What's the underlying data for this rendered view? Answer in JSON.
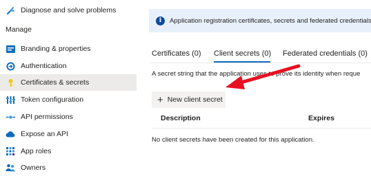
{
  "sidebar": {
    "top_item": {
      "label": "Diagnose and solve problems",
      "icon": "wrench-icon"
    },
    "section_label": "Manage",
    "items": [
      {
        "label": "Branding & properties",
        "icon": "branding-icon",
        "active": false
      },
      {
        "label": "Authentication",
        "icon": "authentication-icon",
        "active": false
      },
      {
        "label": "Certificates & secrets",
        "icon": "key-icon",
        "active": true
      },
      {
        "label": "Token configuration",
        "icon": "token-config-icon",
        "active": false
      },
      {
        "label": "API permissions",
        "icon": "api-permissions-icon",
        "active": false
      },
      {
        "label": "Expose an API",
        "icon": "cloud-icon",
        "active": false
      },
      {
        "label": "App roles",
        "icon": "app-roles-icon",
        "active": false
      },
      {
        "label": "Owners",
        "icon": "owners-icon",
        "active": false
      }
    ]
  },
  "banner": {
    "icon": "info-icon",
    "text": "Application registration certificates, secrets and federated credentials ca"
  },
  "tabs": [
    {
      "label": "Certificates (0)",
      "active": false
    },
    {
      "label": "Client secrets (0)",
      "active": true
    },
    {
      "label": "Federated credentials (0)",
      "active": false
    }
  ],
  "description": "A secret string that the application uses to prove its identity when reque",
  "new_secret_button": {
    "label": "New client secret",
    "icon": "plus-icon"
  },
  "table": {
    "columns": [
      "Description",
      "Expires"
    ],
    "empty_message": "No client secrets have been created for this application."
  },
  "colors": {
    "accent": "#0f6cbd",
    "active_bg": "#edebe9",
    "banner_bg": "#e8f1fb",
    "arrow": "#e81123"
  }
}
